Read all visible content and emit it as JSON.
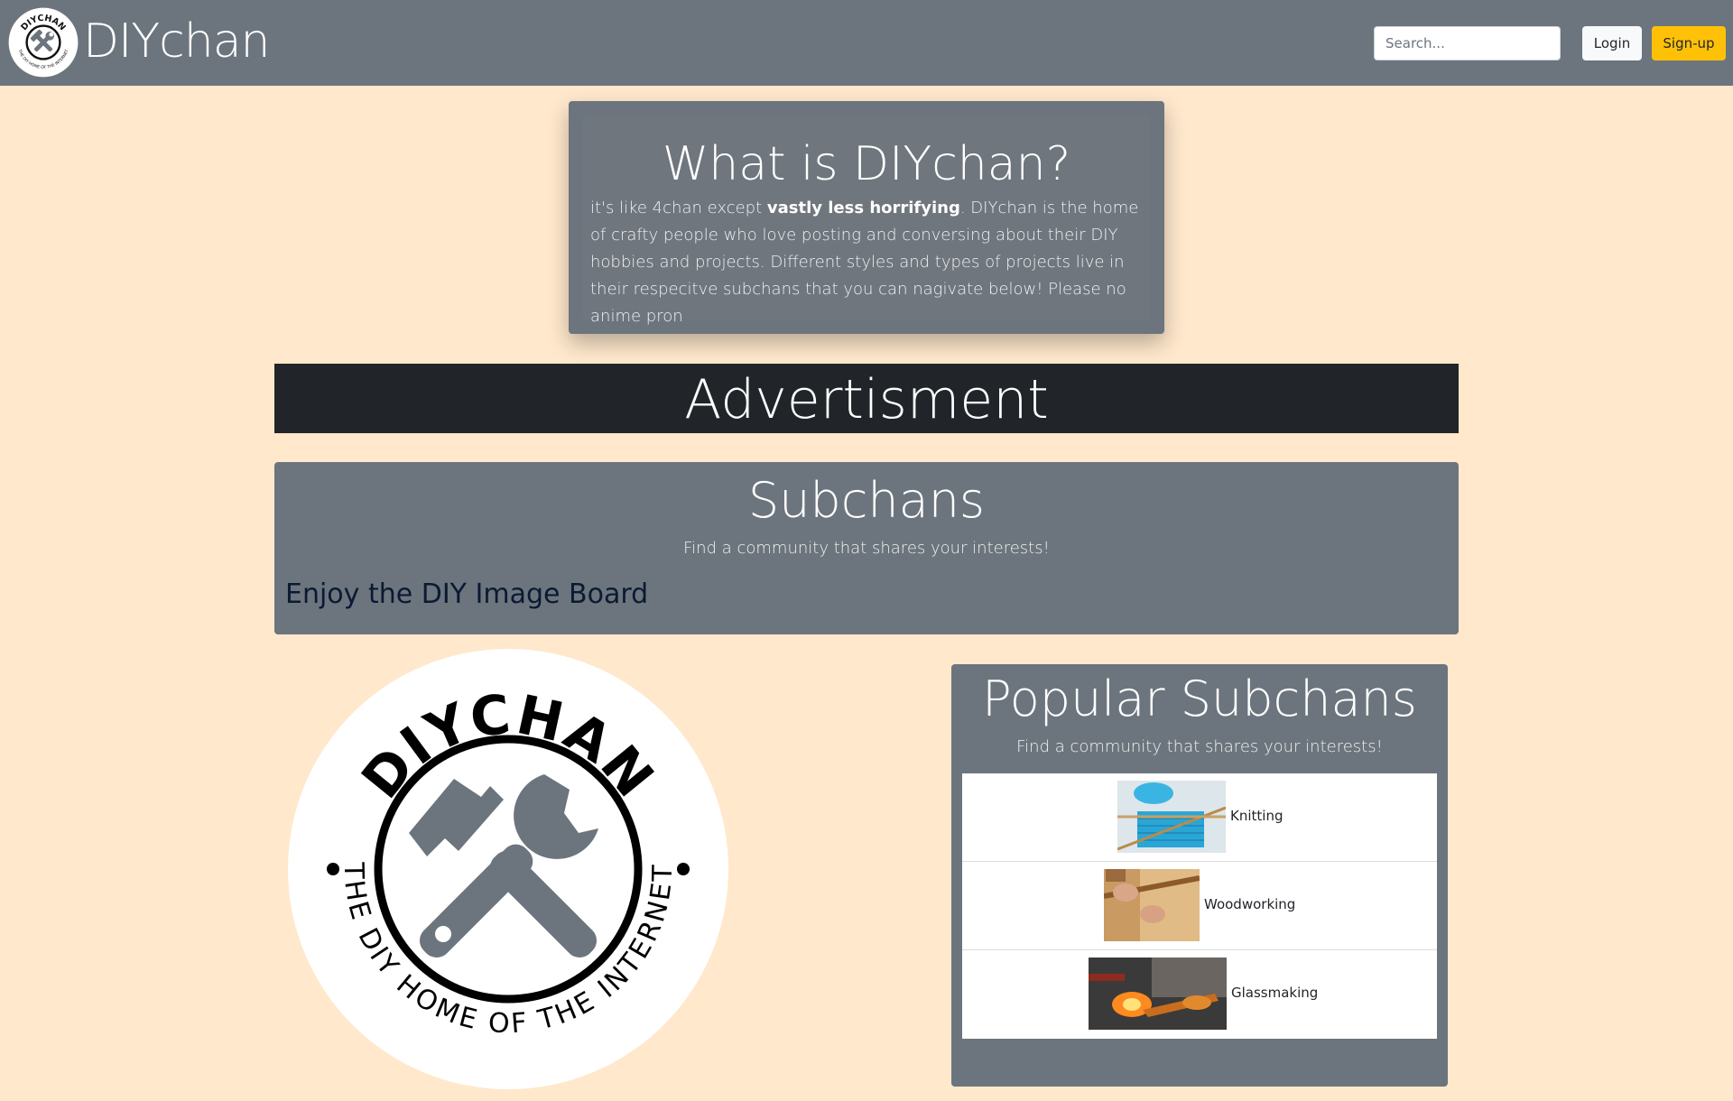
{
  "navbar": {
    "brand": "DIYchan",
    "logo_text_top": "DIYCHAN",
    "logo_text_bottom": "THE DIY HOME OF THE INTERNET",
    "search_placeholder": "Search...",
    "login_label": "Login",
    "signup_label": "Sign-up"
  },
  "about": {
    "title": "What is DIYchan?",
    "text_before": "it's like 4chan except ",
    "text_bold": "vastly less horrifying",
    "text_after": ". DIYchan is the home of crafty people who love posting and conversing about their DIY hobbies and projects. Different styles and types of projects live in their respecitve subchans that you can nagivate below! Please no anime pron"
  },
  "ad": {
    "label": "Advertisment"
  },
  "subchans": {
    "title": "Subchans",
    "subtitle": "Find a community that shares your interests!",
    "tagline": "Enjoy the DIY Image Board"
  },
  "logo": {
    "top_text": "DIYCHAN",
    "bottom_text": "THE DIY HOME OF THE INTERNET"
  },
  "popular": {
    "title": "Popular Subchans",
    "subtitle": "Find a community that shares your interests!",
    "items": [
      {
        "label": "Knitting"
      },
      {
        "label": "Woodworking"
      },
      {
        "label": "Glassmaking"
      }
    ]
  },
  "colors": {
    "page_bg": "#ffe8cc",
    "navbar": "#6c757d",
    "signup": "#ffc107",
    "ad": "#212529"
  }
}
